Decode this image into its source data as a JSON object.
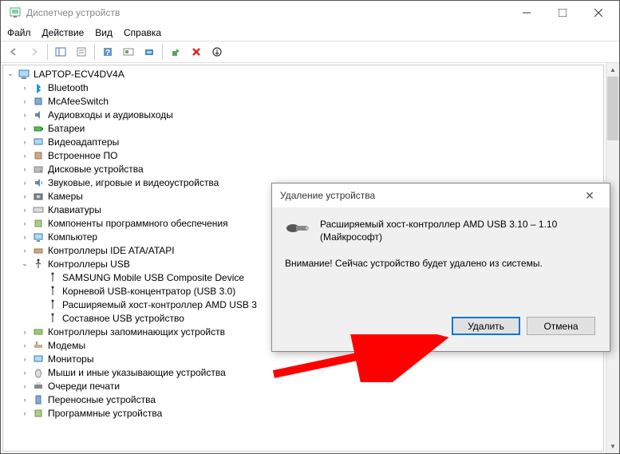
{
  "window": {
    "title": "Диспетчер устройств"
  },
  "menu": {
    "file": "Файл",
    "action": "Действие",
    "view": "Вид",
    "help": "Справка"
  },
  "tree": {
    "root": "LAPTOP-ECV4DV4A",
    "bluetooth": "Bluetooth",
    "mcafee": "McAfeeSwitch",
    "audio": "Аудиовходы и аудиовыходы",
    "battery": "Батареи",
    "video": "Видеоадаптеры",
    "firmware": "Встроенное ПО",
    "disk": "Дисковые устройства",
    "sound": "Звуковые, игровые и видеоустройства",
    "camera": "Камеры",
    "keyboard": "Клавиатуры",
    "software": "Компоненты программного обеспечения",
    "computer": "Компьютер",
    "ide": "Контроллеры IDE ATA/ATAPI",
    "usb": "Контроллеры USB",
    "usb_samsung": "SAMSUNG Mobile USB Composite Device",
    "usb_root": "Корневой USB-концентратор (USB 3.0)",
    "usb_amd": "Расширяемый хост-контроллер AMD USB 3",
    "usb_composite": "Составное USB устройство",
    "storage": "Контроллеры запоминающих устройств",
    "modem": "Модемы",
    "monitor": "Мониторы",
    "mouse": "Мыши и иные указывающие устройства",
    "printqueue": "Очереди печати",
    "portable": "Переносные устройства",
    "softdev": "Программные устройства"
  },
  "dialog": {
    "title": "Удаление устройства",
    "device": "Расширяемый хост-контроллер AMD USB 3.10 – 1.10 (Майкрософт)",
    "warning": "Внимание! Сейчас устройство будет удалено из системы.",
    "delete": "Удалить",
    "cancel": "Отмена"
  }
}
